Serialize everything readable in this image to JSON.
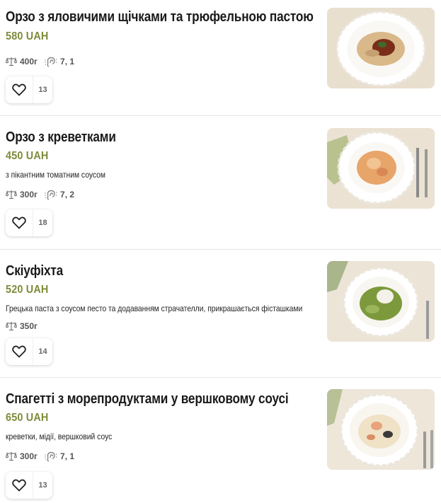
{
  "menu": {
    "items": [
      {
        "title": "Орзо з яловичими щічками та трюфельною пастою",
        "price": "580 UAH",
        "description": "",
        "weight": "400г",
        "rating": "7, 1",
        "likes": "13",
        "photo": "dish-orzo-beef-cheeks"
      },
      {
        "title": "Орзо з креветками",
        "price": "450 UAH",
        "description": "з пікантним томатним соусом",
        "weight": "300г",
        "rating": "7, 2",
        "likes": "18",
        "photo": "dish-orzo-shrimp"
      },
      {
        "title": "Скіуфіхта",
        "price": "520 UAH",
        "description": "Грецька паста з соусом песто та додаванням страчателли, прикрашається фісташками",
        "weight": "350г",
        "rating": "",
        "likes": "14",
        "photo": "dish-skioufikta-pesto"
      },
      {
        "title": "Спагетті з морепродуктами у вершковому соусі",
        "price": "650 UAH",
        "description": "креветки, мідії, вершковий соус",
        "weight": "300г",
        "rating": "7, 1",
        "likes": "13",
        "photo": "dish-spaghetti-seafood"
      }
    ]
  },
  "icons": {
    "weight": "scale-icon",
    "rating": "ear-icon",
    "like": "heart-icon"
  },
  "colors": {
    "price": "#7e8b3a",
    "title": "#1a1a1a",
    "divider": "#e6e6e6"
  }
}
